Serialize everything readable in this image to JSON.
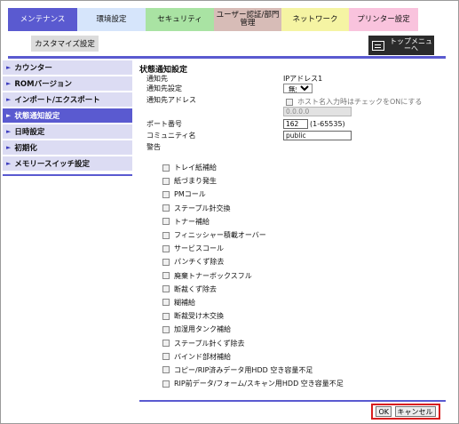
{
  "tabs": [
    {
      "label": "メンテナンス",
      "active": true,
      "color": "#5a5ad0"
    },
    {
      "label": "環境設定",
      "color": "#d6e5fb"
    },
    {
      "label": "セキュリティ",
      "color": "#a9e3a3"
    },
    {
      "label": "ユーザー認証/部門管理",
      "color": "#d7bcb7"
    },
    {
      "label": "ネットワーク",
      "color": "#f5f4a3"
    },
    {
      "label": "プリンター設定",
      "color": "#f9c3dd"
    }
  ],
  "sub_tab": "カスタマイズ設定",
  "top_menu": {
    "label": "トップメニューへ",
    "icon": "top-menu-icon"
  },
  "sidebar": {
    "items": [
      {
        "label": "カウンター"
      },
      {
        "label": "ROMバージョン"
      },
      {
        "label": "インポート/エクスポート"
      },
      {
        "label": "状態通知設定",
        "active": true
      },
      {
        "label": "日時設定"
      },
      {
        "label": "初期化"
      },
      {
        "label": "メモリースイッチ設定"
      }
    ],
    "arrow": "►"
  },
  "main": {
    "title": "状態通知設定",
    "dest_label": "通知先",
    "dest_value": "IPアドレス1",
    "setting_label": "通知先設定",
    "setting_value": "無効",
    "setting_options": [
      "無効"
    ],
    "address_label": "通知先アドレス",
    "host_checkbox_label": "ホスト名入力時はチェックをONにする",
    "address_value": "0.0.0.0",
    "port_label": "ポート番号",
    "port_value": "162",
    "port_range": "(1-65535)",
    "community_label": "コミュニティ名",
    "community_value": "public",
    "alert_label": "警告",
    "alerts": [
      "トレイ紙補給",
      "紙づまり発生",
      "PMコール",
      "ステープル針交換",
      "トナー補給",
      "フィニッシャー積載オーバー",
      "サービスコール",
      "パンチくず除去",
      "廃棄トナーボックスフル",
      "断裁くず除去",
      "糊補給",
      "断裁受け木交換",
      "加湿用タンク補給",
      "ステープル針くず除去",
      "バインド部材補給",
      "コピー/RIP済みデータ用HDD 空き容量不足",
      "RIP前データ/フォーム/スキャン用HDD 空き容量不足"
    ]
  },
  "buttons": {
    "ok": "OK",
    "cancel": "キャンセル"
  }
}
